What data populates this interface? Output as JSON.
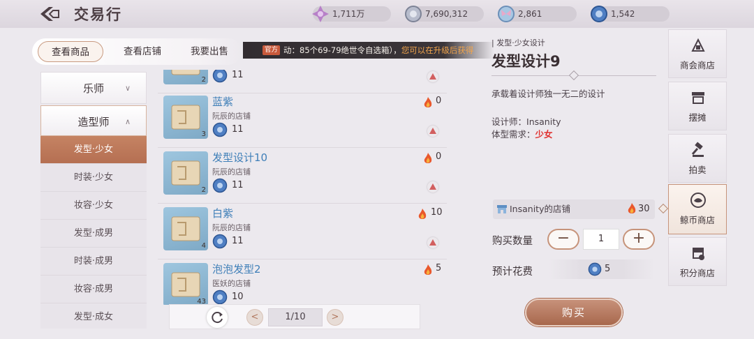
{
  "header": {
    "title": "交易行",
    "currencies": [
      {
        "icon": "star-crystal-icon",
        "value": "1,711万"
      },
      {
        "icon": "silver-coin-icon",
        "value": "7,690,312"
      },
      {
        "icon": "butterfly-coin-icon",
        "value": "2,861"
      },
      {
        "icon": "whale-coin-icon",
        "value": "1,542"
      }
    ]
  },
  "tabs": [
    {
      "label": "查看商品",
      "active": true
    },
    {
      "label": "查看店铺",
      "active": false
    },
    {
      "label": "我要出售",
      "active": false
    }
  ],
  "ticker": {
    "badge": "官方",
    "text": "动：85个69-79绝世令自选箱），",
    "highlight": "您可以在升级后获得"
  },
  "categories": {
    "musician": "乐师",
    "stylist": "造型师",
    "subs": [
      "发型·少女",
      "时装·少女",
      "妆容·少女",
      "发型·成男",
      "时装·成男",
      "妆容·成男",
      "发型·成女"
    ]
  },
  "items": [
    {
      "name": "",
      "shop": "",
      "qty": "2",
      "price": "11",
      "heat": ""
    },
    {
      "name": "蓝紫",
      "shop": "阮辰的店铺",
      "qty": "3",
      "price": "11",
      "heat": "0"
    },
    {
      "name": "发型设计10",
      "shop": "阮辰的店铺",
      "qty": "2",
      "price": "11",
      "heat": "0"
    },
    {
      "name": "白紫",
      "shop": "阮辰的店铺",
      "qty": "4",
      "price": "11",
      "heat": "10"
    },
    {
      "name": "泡泡发型2",
      "shop": "医妖的店铺",
      "qty": "43",
      "price": "10",
      "heat": "5"
    }
  ],
  "pager": {
    "page": "1/10",
    "prev": "<",
    "next": ">"
  },
  "detail": {
    "category": "| 发型·少女设计",
    "name": "发型设计9",
    "description": "承载着设计师独一无二的设计",
    "designer_label": "设计师：",
    "designer": "Insanity",
    "body_label": "体型需求：",
    "body": "少女",
    "shop": "Insanity的店铺",
    "shop_heat": "30",
    "qty_label": "购买数量",
    "qty_minus": "−",
    "qty": "1",
    "qty_plus": "+",
    "cost_label": "预计花费",
    "cost": "5",
    "buy": "购买"
  },
  "nav": [
    {
      "label": "商会商店",
      "icon": "chamber-shop-icon"
    },
    {
      "label": "摆摊",
      "icon": "stall-icon"
    },
    {
      "label": "拍卖",
      "icon": "gavel-icon"
    },
    {
      "label": "鲸币商店",
      "icon": "whale-coin-icon",
      "active": true
    },
    {
      "label": "积分商店",
      "icon": "points-shop-icon"
    }
  ]
}
